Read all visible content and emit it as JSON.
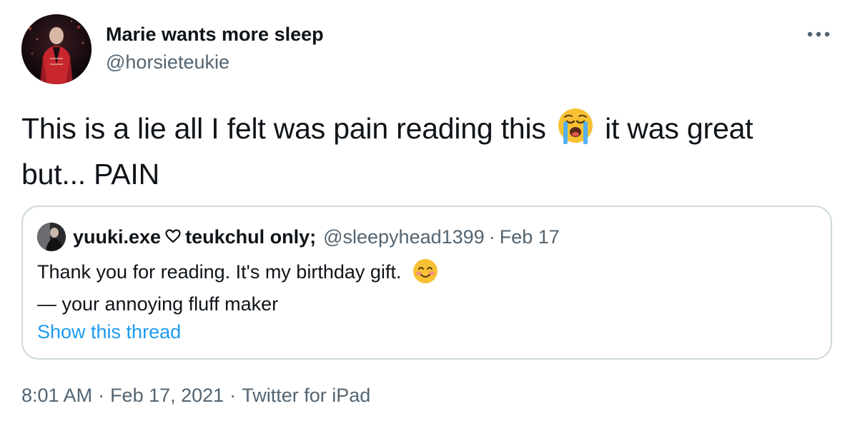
{
  "author": {
    "name": "Marie wants more sleep",
    "handle": "@horsieteukie"
  },
  "more_icon": "more-horizontal-icon",
  "tweet": {
    "text_before_emoji": "This is a lie all I felt was pain reading this",
    "emoji": "loudly-crying-face",
    "text_after_emoji": "it was great",
    "text_line2": "but... PAIN"
  },
  "quoted_tweet": {
    "name_part1": "yuuki.exe",
    "heart_icon": "heart-outline-icon",
    "name_part2": "teukchul only;",
    "handle": "@sleepyhead1399",
    "separator": "·",
    "date": "Feb 17",
    "text_line1": "Thank you for reading. It's my birthday gift.",
    "text_emoji": "smiling-face-with-smiling-eyes",
    "text_line2": "— your annoying fluff maker",
    "show_thread": "Show this thread"
  },
  "footer": {
    "time": "8:01 AM",
    "separator": "·",
    "date": "Feb 17, 2021",
    "source": "Twitter for iPad"
  },
  "colors": {
    "text_primary": "#0f1419",
    "text_secondary": "#536471",
    "link": "#1d9bf0",
    "border": "#cfd9de"
  }
}
